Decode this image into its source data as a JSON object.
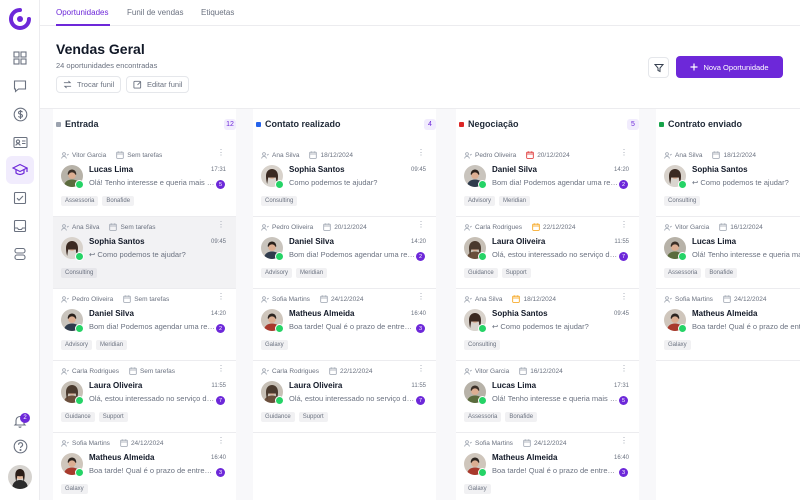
{
  "tabs": [
    {
      "label": "Oportunidades",
      "active": true
    },
    {
      "label": "Funil de vendas",
      "active": false
    },
    {
      "label": "Etiquetas",
      "active": false
    }
  ],
  "header": {
    "title": "Vendas Geral",
    "subtitle": "24 oportunidades encontradas",
    "switch_funnel": "Trocar funil",
    "edit_funnel": "Editar funil",
    "new_button": "Nova Oportunidade"
  },
  "sidebar": {
    "notification_count": "2",
    "icons": [
      "dashboard-icon",
      "chat-icon",
      "dollar-icon",
      "contact-card-icon",
      "graduation-cap-icon",
      "checklist-icon",
      "inbox-icon",
      "database-icon"
    ]
  },
  "colors": {
    "accent": "#6d28d9",
    "whatsapp": "#25d366"
  },
  "columns": [
    {
      "title": "Entrada",
      "count": "12",
      "color": "#9ca3af",
      "cards": [
        {
          "owner": "Vitor Garcia",
          "task": "Sem tarefas",
          "task_type": "none",
          "name": "Lucas Lima",
          "time": "17:31",
          "message": "Olá! Tenho interesse e queria mais informações",
          "reply": false,
          "unread": "5",
          "tags": [
            "Assessoria",
            "Bonafide"
          ],
          "avatar": "m2",
          "highlight": false
        },
        {
          "owner": "Ana Silva",
          "task": "Sem tarefas",
          "task_type": "none",
          "name": "Sophia Santos",
          "time": "09:45",
          "message": "Como podemos te ajudar?",
          "reply": true,
          "unread": "",
          "tags": [
            "Consulting"
          ],
          "avatar": "f1",
          "highlight": true
        },
        {
          "owner": "Pedro Oliveira",
          "task": "Sem tarefas",
          "task_type": "none",
          "name": "Daniel Silva",
          "time": "14:20",
          "message": "Bom dia! Podemos agendar uma reunião?",
          "reply": false,
          "unread": "2",
          "tags": [
            "Advisory",
            "Meridian"
          ],
          "avatar": "m1",
          "highlight": false
        },
        {
          "owner": "Carla Rodrigues",
          "task": "Sem tarefas",
          "task_type": "none",
          "name": "Laura Oliveira",
          "time": "11:55",
          "message": "Olá, estou interessado no serviço de vocês",
          "reply": false,
          "unread": "7",
          "tags": [
            "Guidance",
            "Support"
          ],
          "avatar": "f2",
          "highlight": false
        },
        {
          "owner": "Sofia Martins",
          "task": "24/12/2024",
          "task_type": "normal",
          "name": "Matheus Almeida",
          "time": "16:40",
          "message": "Boa tarde! Qual é o prazo de entrega?",
          "reply": false,
          "unread": "3",
          "tags": [
            "Galaxy"
          ],
          "avatar": "m3",
          "highlight": false
        }
      ]
    },
    {
      "title": "Contato realizado",
      "count": "4",
      "color": "#2563eb",
      "cards": [
        {
          "owner": "Ana Silva",
          "task": "18/12/2024",
          "task_type": "normal",
          "name": "Sophia Santos",
          "time": "09:45",
          "message": "Como podemos te ajudar?",
          "reply": false,
          "unread": "",
          "tags": [
            "Consulting"
          ],
          "avatar": "f1",
          "highlight": false
        },
        {
          "owner": "Pedro Oliveira",
          "task": "20/12/2024",
          "task_type": "normal",
          "name": "Daniel Silva",
          "time": "14:20",
          "message": "Bom dia! Podemos agendar uma reunião?",
          "reply": false,
          "unread": "2",
          "tags": [
            "Advisory",
            "Meridian"
          ],
          "avatar": "m1",
          "highlight": false
        },
        {
          "owner": "Sofia Martins",
          "task": "24/12/2024",
          "task_type": "normal",
          "name": "Matheus Almeida",
          "time": "16:40",
          "message": "Boa tarde! Qual é o prazo de entrega?",
          "reply": false,
          "unread": "3",
          "tags": [
            "Galaxy"
          ],
          "avatar": "m3",
          "highlight": false
        },
        {
          "owner": "Carla Rodrigues",
          "task": "22/12/2024",
          "task_type": "normal",
          "name": "Laura Oliveira",
          "time": "11:55",
          "message": "Olá, estou interessado no serviço de vocês",
          "reply": false,
          "unread": "7",
          "tags": [
            "Guidance",
            "Support"
          ],
          "avatar": "f2",
          "highlight": false
        }
      ]
    },
    {
      "title": "Negociação",
      "count": "5",
      "color": "#dc2626",
      "cards": [
        {
          "owner": "Pedro Oliveira",
          "task": "20/12/2024",
          "task_type": "overdue",
          "name": "Daniel Silva",
          "time": "14:20",
          "message": "Bom dia! Podemos agendar uma reunião?",
          "reply": false,
          "unread": "2",
          "tags": [
            "Advisory",
            "Meridian"
          ],
          "avatar": "m1",
          "highlight": false
        },
        {
          "owner": "Carla Rodrigues",
          "task": "22/12/2024",
          "task_type": "today",
          "name": "Laura Oliveira",
          "time": "11:55",
          "message": "Olá, estou interessado no serviço de vocês",
          "reply": false,
          "unread": "7",
          "tags": [
            "Guidance",
            "Support"
          ],
          "avatar": "f2",
          "highlight": false
        },
        {
          "owner": "Ana Silva",
          "task": "18/12/2024",
          "task_type": "today",
          "name": "Sophia Santos",
          "time": "09:45",
          "message": "Como podemos te ajudar?",
          "reply": true,
          "unread": "",
          "tags": [
            "Consulting"
          ],
          "avatar": "f1",
          "highlight": false
        },
        {
          "owner": "Vitor Garcia",
          "task": "16/12/2024",
          "task_type": "normal",
          "name": "Lucas Lima",
          "time": "17:31",
          "message": "Olá! Tenho interesse e queria mais informações",
          "reply": false,
          "unread": "5",
          "tags": [
            "Assessoria",
            "Bonafide"
          ],
          "avatar": "m2",
          "highlight": false
        },
        {
          "owner": "Sofia Martins",
          "task": "24/12/2024",
          "task_type": "normal",
          "name": "Matheus Almeida",
          "time": "16:40",
          "message": "Boa tarde! Qual é o prazo de entrega?",
          "reply": false,
          "unread": "3",
          "tags": [
            "Galaxy"
          ],
          "avatar": "m3",
          "highlight": false
        }
      ]
    },
    {
      "title": "Contrato enviado",
      "count": "",
      "color": "#16a34a",
      "cards": [
        {
          "owner": "Ana Silva",
          "task": "18/12/2024",
          "task_type": "normal",
          "name": "Sophia Santos",
          "time": "",
          "message": "Como podemos te ajudar?",
          "reply": true,
          "unread": "",
          "tags": [
            "Consulting"
          ],
          "avatar": "f1",
          "highlight": false
        },
        {
          "owner": "Vitor Garcia",
          "task": "16/12/2024",
          "task_type": "normal",
          "name": "Lucas Lima",
          "time": "",
          "message": "Olá! Tenho interesse e queria mais informações",
          "reply": false,
          "unread": "",
          "tags": [
            "Assessoria",
            "Bonafide"
          ],
          "avatar": "m2",
          "highlight": false
        },
        {
          "owner": "Sofia Martins",
          "task": "24/12/2024",
          "task_type": "normal",
          "name": "Matheus Almeida",
          "time": "",
          "message": "Boa tarde! Qual é o prazo de entrega?",
          "reply": false,
          "unread": "",
          "tags": [
            "Galaxy"
          ],
          "avatar": "m3",
          "highlight": false
        }
      ]
    }
  ]
}
